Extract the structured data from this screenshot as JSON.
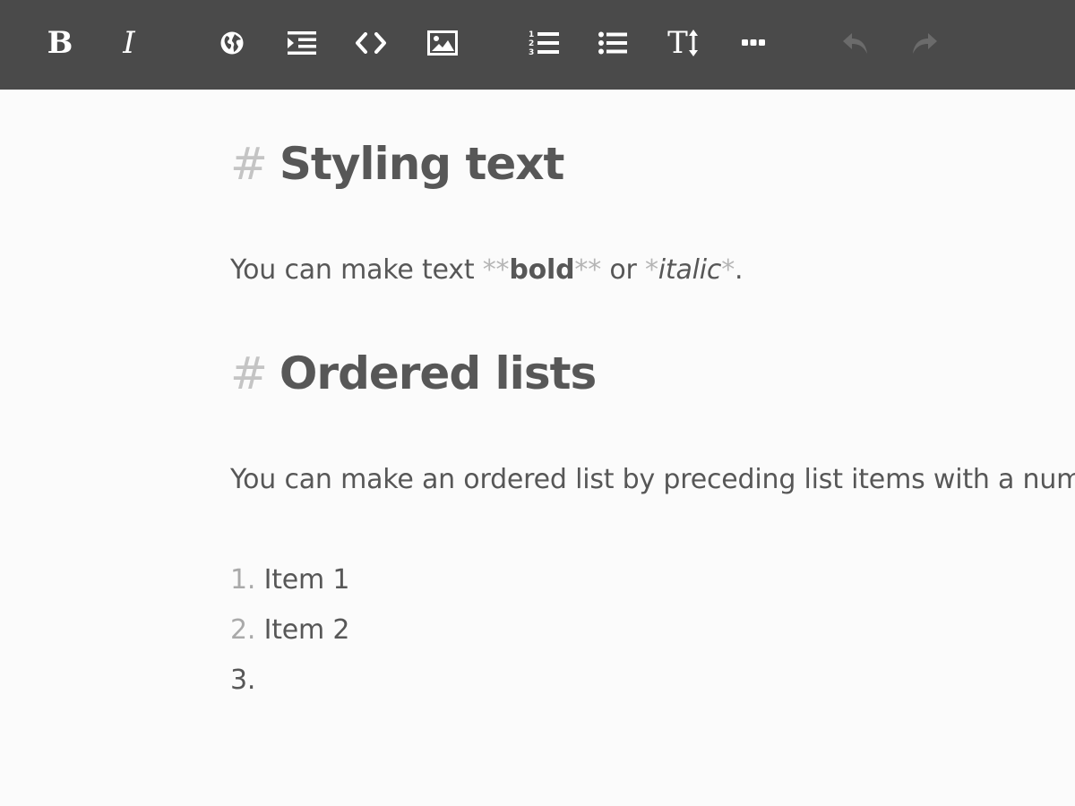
{
  "toolbar": {
    "buttons": [
      {
        "name": "bold",
        "label": "B",
        "icon": "bold-icon"
      },
      {
        "name": "italic",
        "label": "I",
        "icon": "italic-icon"
      },
      {
        "name": "link",
        "icon": "globe-icon"
      },
      {
        "name": "quote",
        "icon": "indent-icon"
      },
      {
        "name": "code",
        "icon": "code-icon"
      },
      {
        "name": "image",
        "icon": "image-icon"
      },
      {
        "name": "ordered-list",
        "icon": "ordered-list-icon",
        "digits": [
          "1",
          "2",
          "3"
        ]
      },
      {
        "name": "unordered-list",
        "icon": "bullet-list-icon"
      },
      {
        "name": "heading",
        "label": "T",
        "icon": "text-size-icon"
      },
      {
        "name": "more",
        "icon": "more-icon"
      },
      {
        "name": "undo",
        "icon": "undo-icon",
        "disabled": true
      },
      {
        "name": "redo",
        "icon": "redo-icon",
        "disabled": true
      }
    ],
    "colors": {
      "background": "#4a4a4a",
      "icon": "#ffffff",
      "disabled_icon": "#6b6b6b"
    }
  },
  "editor": {
    "heading1": {
      "marker": "#",
      "text": "Styling text"
    },
    "paragraph1": {
      "prefix": "You can make text ",
      "bold_marker": "**",
      "bold_text": "bold",
      "middle": " or ",
      "italic_marker": "*",
      "italic_text": "italic",
      "suffix": "."
    },
    "heading2": {
      "marker": "#",
      "text": "Ordered lists"
    },
    "paragraph2": {
      "text": "You can make an ordered list by preceding list items with a num"
    },
    "list": [
      {
        "number": "1.",
        "text": "Item 1"
      },
      {
        "number": "2.",
        "text": "Item 2"
      },
      {
        "number": "3.",
        "text": ""
      }
    ],
    "colors": {
      "background": "#fbfbfb",
      "text": "#575757",
      "markup": "#b5b5b5",
      "heading_marker": "#c4c4c4"
    }
  }
}
